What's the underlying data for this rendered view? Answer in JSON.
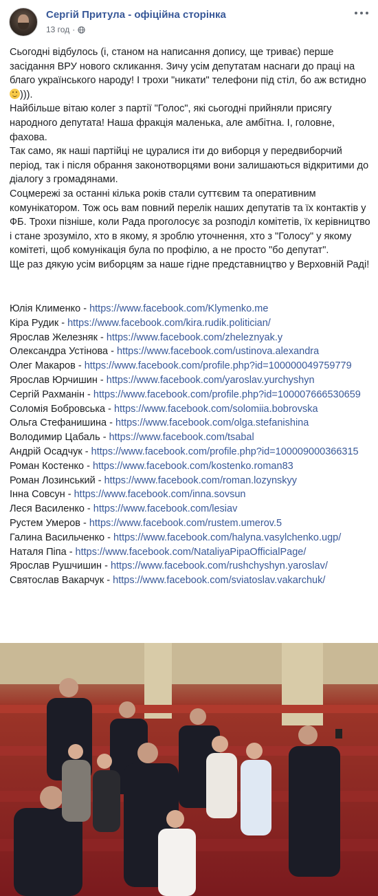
{
  "post": {
    "author": "Сергій Притула - офіційна сторінка",
    "time": "13 год",
    "dot": "·",
    "paragraphs": [
      "Сьогодні відбулось (і, станом на написання допису, ще триває) перше засідання ВРУ нового скликання. Зичу усім депутатам наснаги до праці на благо українського народу! І трохи \"никати\" телефони під стіл, бо аж встидно",
      "Найбільше вітаю колег з партії \"Голос\", які сьогодні прийняли присягу народного депутата! Наша фракція маленька, але амбітна. І, головне, фахова.",
      "Так само, як наші партійці не цуралися іти до виборця у передвиборчий період, так і після обрання законотворцями вони залишаються відкритими до діалогу з громадянами.",
      "Соцмережі за останні кілька років стали суттєвим та оперативним комунікатором. Тож ось вам повний перелік наших депутатів та їх контактів у ФБ. Трохи пізніше, коли Рада проголосує за розподіл комітетів, їх керівництво і стане зрозуміло, хто в якому, я зроблю уточнення, хто з \"Голосу\" у якому комітеті, щоб комунікація була по профілю, а не просто \"бо депутат\".",
      "Ще раз дякую усім виборцям за наше гідне представництво у Верховній Раді!"
    ],
    "emoji_suffix": ")))."
  },
  "contacts": [
    {
      "name": "Юлія Клименко - ",
      "url": "https://www.facebook.com/Klymenko.me"
    },
    {
      "name": "Кіра Рудик - ",
      "url": "https://www.facebook.com/kira.rudik.politician/"
    },
    {
      "name": "Ярослав Железняк - ",
      "url": "https://www.facebook.com/zheleznyak.y"
    },
    {
      "name": "Олександра Устінова - ",
      "url": "https://www.facebook.com/ustinova.alexandra"
    },
    {
      "name": "Олег Макаров - ",
      "url": "https://www.facebook.com/profile.php?id=100000049759779"
    },
    {
      "name": "Ярослав Юрчишин - ",
      "url": "https://www.facebook.com/yaroslav.yurchyshyn"
    },
    {
      "name": "Сергій Рахманін - ",
      "url": "https://www.facebook.com/profile.php?id=100007666530659"
    },
    {
      "name": "Соломія Бобровська - ",
      "url": "https://www.facebook.com/solomiia.bobrovska"
    },
    {
      "name": "Ольга Стефанишина - ",
      "url": "https://www.facebook.com/olga.stefanishina"
    },
    {
      "name": "Володимир Цабаль - ",
      "url": "https://www.facebook.com/tsabal"
    },
    {
      "name": "Андрій Осадчук - ",
      "url": "https://www.facebook.com/profile.php?id=100009000366315"
    },
    {
      "name": "Роман Костенко - ",
      "url": "https://www.facebook.com/kostenko.roman83"
    },
    {
      "name": "Роман Лозинський - ",
      "url": "https://www.facebook.com/roman.lozynskyy"
    },
    {
      "name": "Інна Совсун - ",
      "url": "https://www.facebook.com/inna.sovsun"
    },
    {
      "name": "Леся Василенко - ",
      "url": "https://www.facebook.com/lesiav"
    },
    {
      "name": "Рустем Умеров - ",
      "url": "https://www.facebook.com/rustem.umerov.5"
    },
    {
      "name": "Галина Васильченко - ",
      "url": "https://www.facebook.com/halyna.vasylchenko.ugp/"
    },
    {
      "name": "Наталя Піпа - ",
      "url": "https://www.facebook.com/NataliyaPipaOfficialPage/"
    },
    {
      "name": "Ярослав Рушчишин - ",
      "url": "https://www.facebook.com/rushchyshyn.yaroslav/"
    },
    {
      "name": "Святослав Вакарчук - ",
      "url": "https://www.facebook.com/sviatoslav.vakarchuk/"
    }
  ],
  "icons": {
    "privacy": "globe-icon",
    "menu": "more-icon",
    "emoji": "smiley-emoji"
  },
  "colors": {
    "link": "#385898",
    "text": "#1c1e21",
    "meta": "#616770"
  }
}
